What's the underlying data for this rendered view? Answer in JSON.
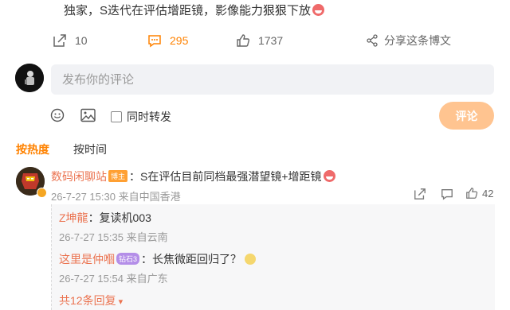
{
  "post": {
    "text": "独家，S迭代在评估增距镜，影像能力狠狠下放",
    "emoji": "laugh-emoji"
  },
  "actions": {
    "repost_count": "10",
    "comment_count": "295",
    "like_count": "1737",
    "share_label": "分享这条博文"
  },
  "composer": {
    "placeholder": "发布你的评论",
    "also_repost_label": "同时转发",
    "submit_label": "评论"
  },
  "sort": {
    "hot": "按热度",
    "time": "按时间"
  },
  "comment": {
    "username": "数码闲聊站",
    "badge": "博主",
    "text": "：S在评估目前同档最强潜望镜+增距镜",
    "meta": "26-7-27 15:30 来自中国香港",
    "like_count": "42"
  },
  "replies": [
    {
      "username": "Z坤龍",
      "text": "：复读机003",
      "meta": "26-7-27 15:35 来自云南"
    },
    {
      "username": "这里是仲嗰",
      "badge": "钻石3",
      "text": "：长焦微距回归了？",
      "meta": "26-7-27 15:54 来自广东"
    }
  ],
  "more_replies": "共12条回复",
  "colors": {
    "accent": "#ff8200",
    "link": "#eb7350",
    "submit_bg": "#ffc490"
  }
}
